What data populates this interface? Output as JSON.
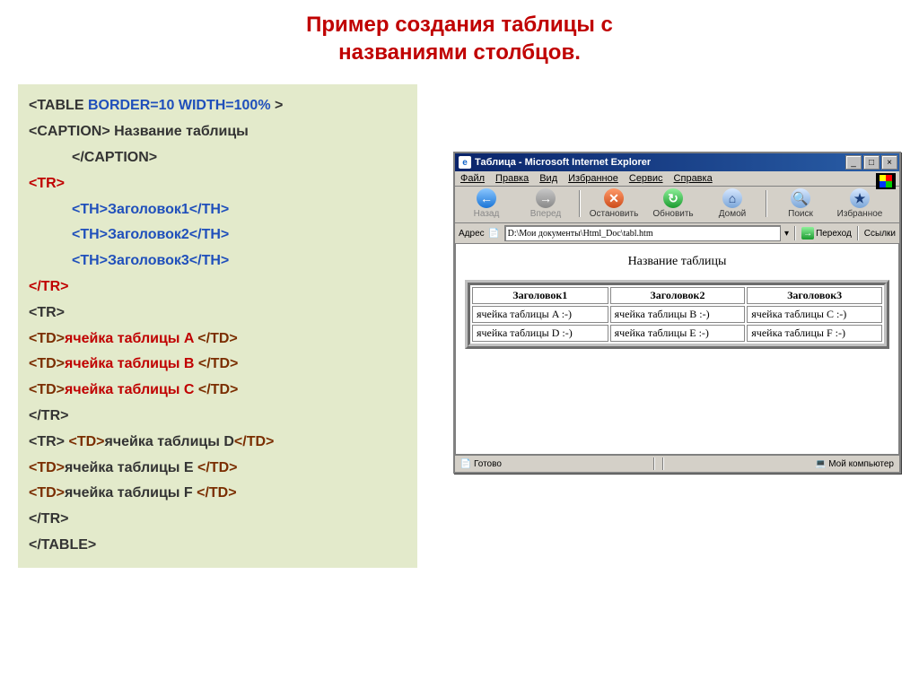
{
  "slide": {
    "title_line1": "Пример создания таблицы с",
    "title_line2": "названиями столбцов."
  },
  "code": {
    "l1a": "<TABLE ",
    "l1b": "BORDER=10 WIDTH=100% ",
    "l1c": ">",
    "l2a": "<CAPTION>",
    "l2b": " Название  таблицы",
    "l3a": "</CAPTION>",
    "l4": "<TR>",
    "l5a": "<TH>",
    "l5b": "Заголовок1",
    "l5c": "</TH>",
    "l6a": "<TH>",
    "l6b": "Заголовок2",
    "l6c": "</TH>",
    "l7a": "<TH>",
    "l7b": "Заголовок3",
    "l7c": "</TH>",
    "l8": "</TR>",
    "l9": "<TR>",
    "l10a": "<TD>",
    "l10b": "ячейка таблицы A ",
    "l10c": "</TD>",
    "l11a": "<TD>",
    "l11b": "ячейка таблицы B ",
    "l11c": "</TD>",
    "l12a": "<TD>",
    "l12b": "ячейка таблицы C ",
    "l12c": "</TD>",
    "l13": "</TR>",
    "l14a": "<TR>  ",
    "l14b": "<TD>",
    "l14c": "ячейка таблицы D",
    "l14d": "</TD>",
    "l15a": "<TD>",
    "l15b": "ячейка таблицы E ",
    "l15c": "</TD>",
    "l16a": "<TD>",
    "l16b": "ячейка таблицы F ",
    "l16c": "</TD>",
    "l17": "</TR>",
    "l18": "</TABLE>"
  },
  "ie": {
    "title": "Таблица - Microsoft Internet Explorer",
    "menu": {
      "file": "Файл",
      "edit": "Правка",
      "view": "Вид",
      "fav": "Избранное",
      "tools": "Сервис",
      "help": "Справка"
    },
    "toolbar": {
      "back": "Назад",
      "forward": "Вперед",
      "stop": "Остановить",
      "refresh": "Обновить",
      "home": "Домой",
      "search": "Поиск",
      "favorites": "Избранное"
    },
    "address_label": "Адрес",
    "address_value": "D:\\Мои документы\\Html_Doc\\tabl.htm",
    "go": "Переход",
    "links": "Ссылки",
    "status_ready": "Готово",
    "status_zone": "Мой компьютер"
  },
  "table": {
    "caption": "Название таблицы",
    "h1": "Заголовок1",
    "h2": "Заголовок2",
    "h3": "Заголовок3",
    "a": "ячейка таблицы A :-)",
    "b": "ячейка таблицы B :-)",
    "c": "ячейка таблицы C :-)",
    "d": "ячейка таблицы D :-)",
    "e": "ячейка таблицы E :-)",
    "f": "ячейка таблицы F :-)"
  },
  "glyphs": {
    "minimize": "_",
    "maximize": "□",
    "close": "×",
    "back": "←",
    "forward": "→",
    "stop": "✕",
    "refresh": "↻",
    "home": "⌂",
    "search": "🔍",
    "star": "★",
    "doc": "📄",
    "go": "→",
    "ready": "📄",
    "pc": "💻",
    "dropdown": "▾"
  }
}
